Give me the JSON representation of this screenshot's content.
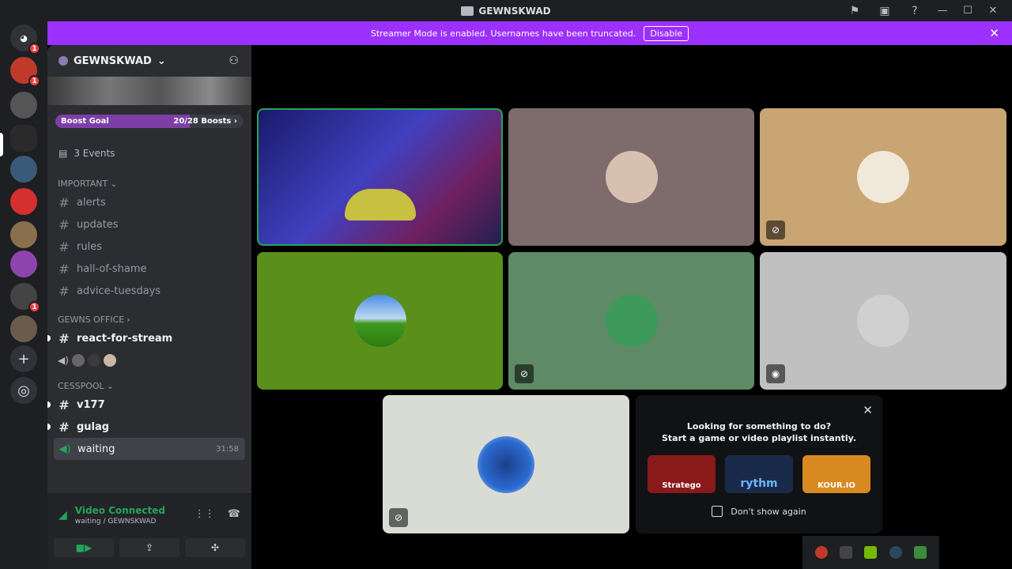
{
  "window": {
    "title": "GEWNSKWAD"
  },
  "banner": {
    "text": "Streamer Mode is enabled. Usernames have been truncated.",
    "button": "Disable"
  },
  "rail": {
    "badges": [
      "1",
      "1",
      "1"
    ]
  },
  "server": {
    "name": "GEWNSKWAD",
    "boost_label": "Boost Goal",
    "boost_count": "20/28 Boosts",
    "boost_progress": 0.714,
    "events": "3 Events"
  },
  "categories": {
    "important": "IMPORTANT",
    "office": "GEWNS OFFICE",
    "cesspool": "CESSPOOL"
  },
  "channels": {
    "important": [
      "alerts",
      "updates",
      "rules",
      "hall-of-shame",
      "advice-tuesdays"
    ],
    "office": "react-for-stream",
    "cesspool": [
      "v177",
      "gulag"
    ],
    "waiting": "waiting",
    "waiting_timer": "31:58"
  },
  "voice": {
    "status": "Video Connected",
    "location": "waiting / GEWNSKWAD"
  },
  "activity": {
    "line1": "Looking for something to do?",
    "line2": "Start a game or video playlist instantly.",
    "games": [
      "Stratego",
      "rythm",
      "KOUR.IO"
    ],
    "dont_show": "Don't show again"
  },
  "colors": {
    "accent_purple": "#9b30ff",
    "connected_green": "#23a55a",
    "tile_green": "#5b8f1c",
    "tile_teal": "#5e8a66",
    "tile_tan": "#c9a574",
    "tile_mauve": "#7e6b6b",
    "tile_grey": "#c0c0c0"
  }
}
